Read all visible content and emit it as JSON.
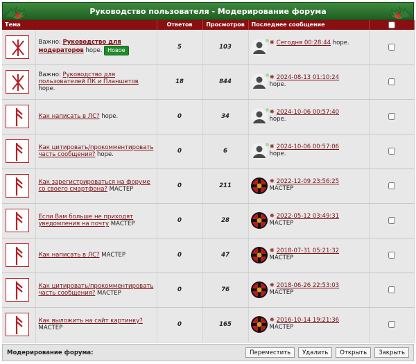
{
  "title": "Руководство пользователя - Модерирование форума",
  "headers": {
    "topic": "Тема",
    "replies": "Ответов",
    "views": "Просмотров",
    "last": "Последнее сообщение"
  },
  "topics": [
    {
      "important": "Важно:",
      "title": "Руководство для модераторов",
      "author": "hope.",
      "badge": "Новое",
      "replies": "5",
      "views": "103",
      "last_date": "Сегодня 00:28:44",
      "last_author": "hope.",
      "avatar": "user"
    },
    {
      "important": "Важно:",
      "title": "Руководство для пользователей ПК и Планшетов",
      "author": "hope.",
      "replies": "18",
      "views": "844",
      "last_date": "2024-08-13 01:10:24",
      "last_author": "hope.",
      "avatar": "user"
    },
    {
      "title": "Как написать в ЛС?",
      "author": "hope.",
      "replies": "0",
      "views": "34",
      "last_date": "2024-10-06 00:57:40",
      "last_author": "hope.",
      "avatar": "user"
    },
    {
      "title": "Как цитировать/прокомментировать часть сообщения?",
      "author": "hope.",
      "replies": "0",
      "views": "6",
      "last_date": "2024-10-06 00:57:06",
      "last_author": "hope.",
      "avatar": "user"
    },
    {
      "title": "Как зарегистрироваться на форуме со своего смартфона?",
      "author": "МАСТЕР",
      "replies": "0",
      "views": "211",
      "last_date": "2022-12-09 23:56:25",
      "last_author": "МАСТЕР",
      "avatar": "master"
    },
    {
      "title": "Если Вам больше не приходят уведомления на почту",
      "author": "МАСТЕР",
      "replies": "0",
      "views": "28",
      "last_date": "2022-05-12 03:49:31",
      "last_author": "МАСТЕР",
      "avatar": "master"
    },
    {
      "title": "Как написать в ЛС?",
      "author": "МАСТЕР",
      "replies": "0",
      "views": "47",
      "last_date": "2018-07-31 05:21:32",
      "last_author": "МАСТЕР",
      "avatar": "master"
    },
    {
      "title": "Как цитировать/прокомментировать часть сообщения?",
      "author": "МАСТЕР",
      "replies": "0",
      "views": "76",
      "last_date": "2018-06-26 22:53:03",
      "last_author": "МАСТЕР",
      "avatar": "master"
    },
    {
      "title": "Как выложить на сайт картинку?",
      "author": "МАСТЕР",
      "replies": "0",
      "views": "165",
      "last_date": "2016-10-14 19:21:36",
      "last_author": "МАСТЕР",
      "avatar": "master"
    }
  ],
  "footer": {
    "label": "Модерирование форума:",
    "buttons": [
      "Переместить",
      "Удалить",
      "Открыть",
      "Закрыть"
    ]
  },
  "colors": {
    "header_red": "#8a0f12",
    "title_green": "#1f5e21",
    "link": "#7a0d10",
    "badge_green": "#1e8a2c"
  }
}
